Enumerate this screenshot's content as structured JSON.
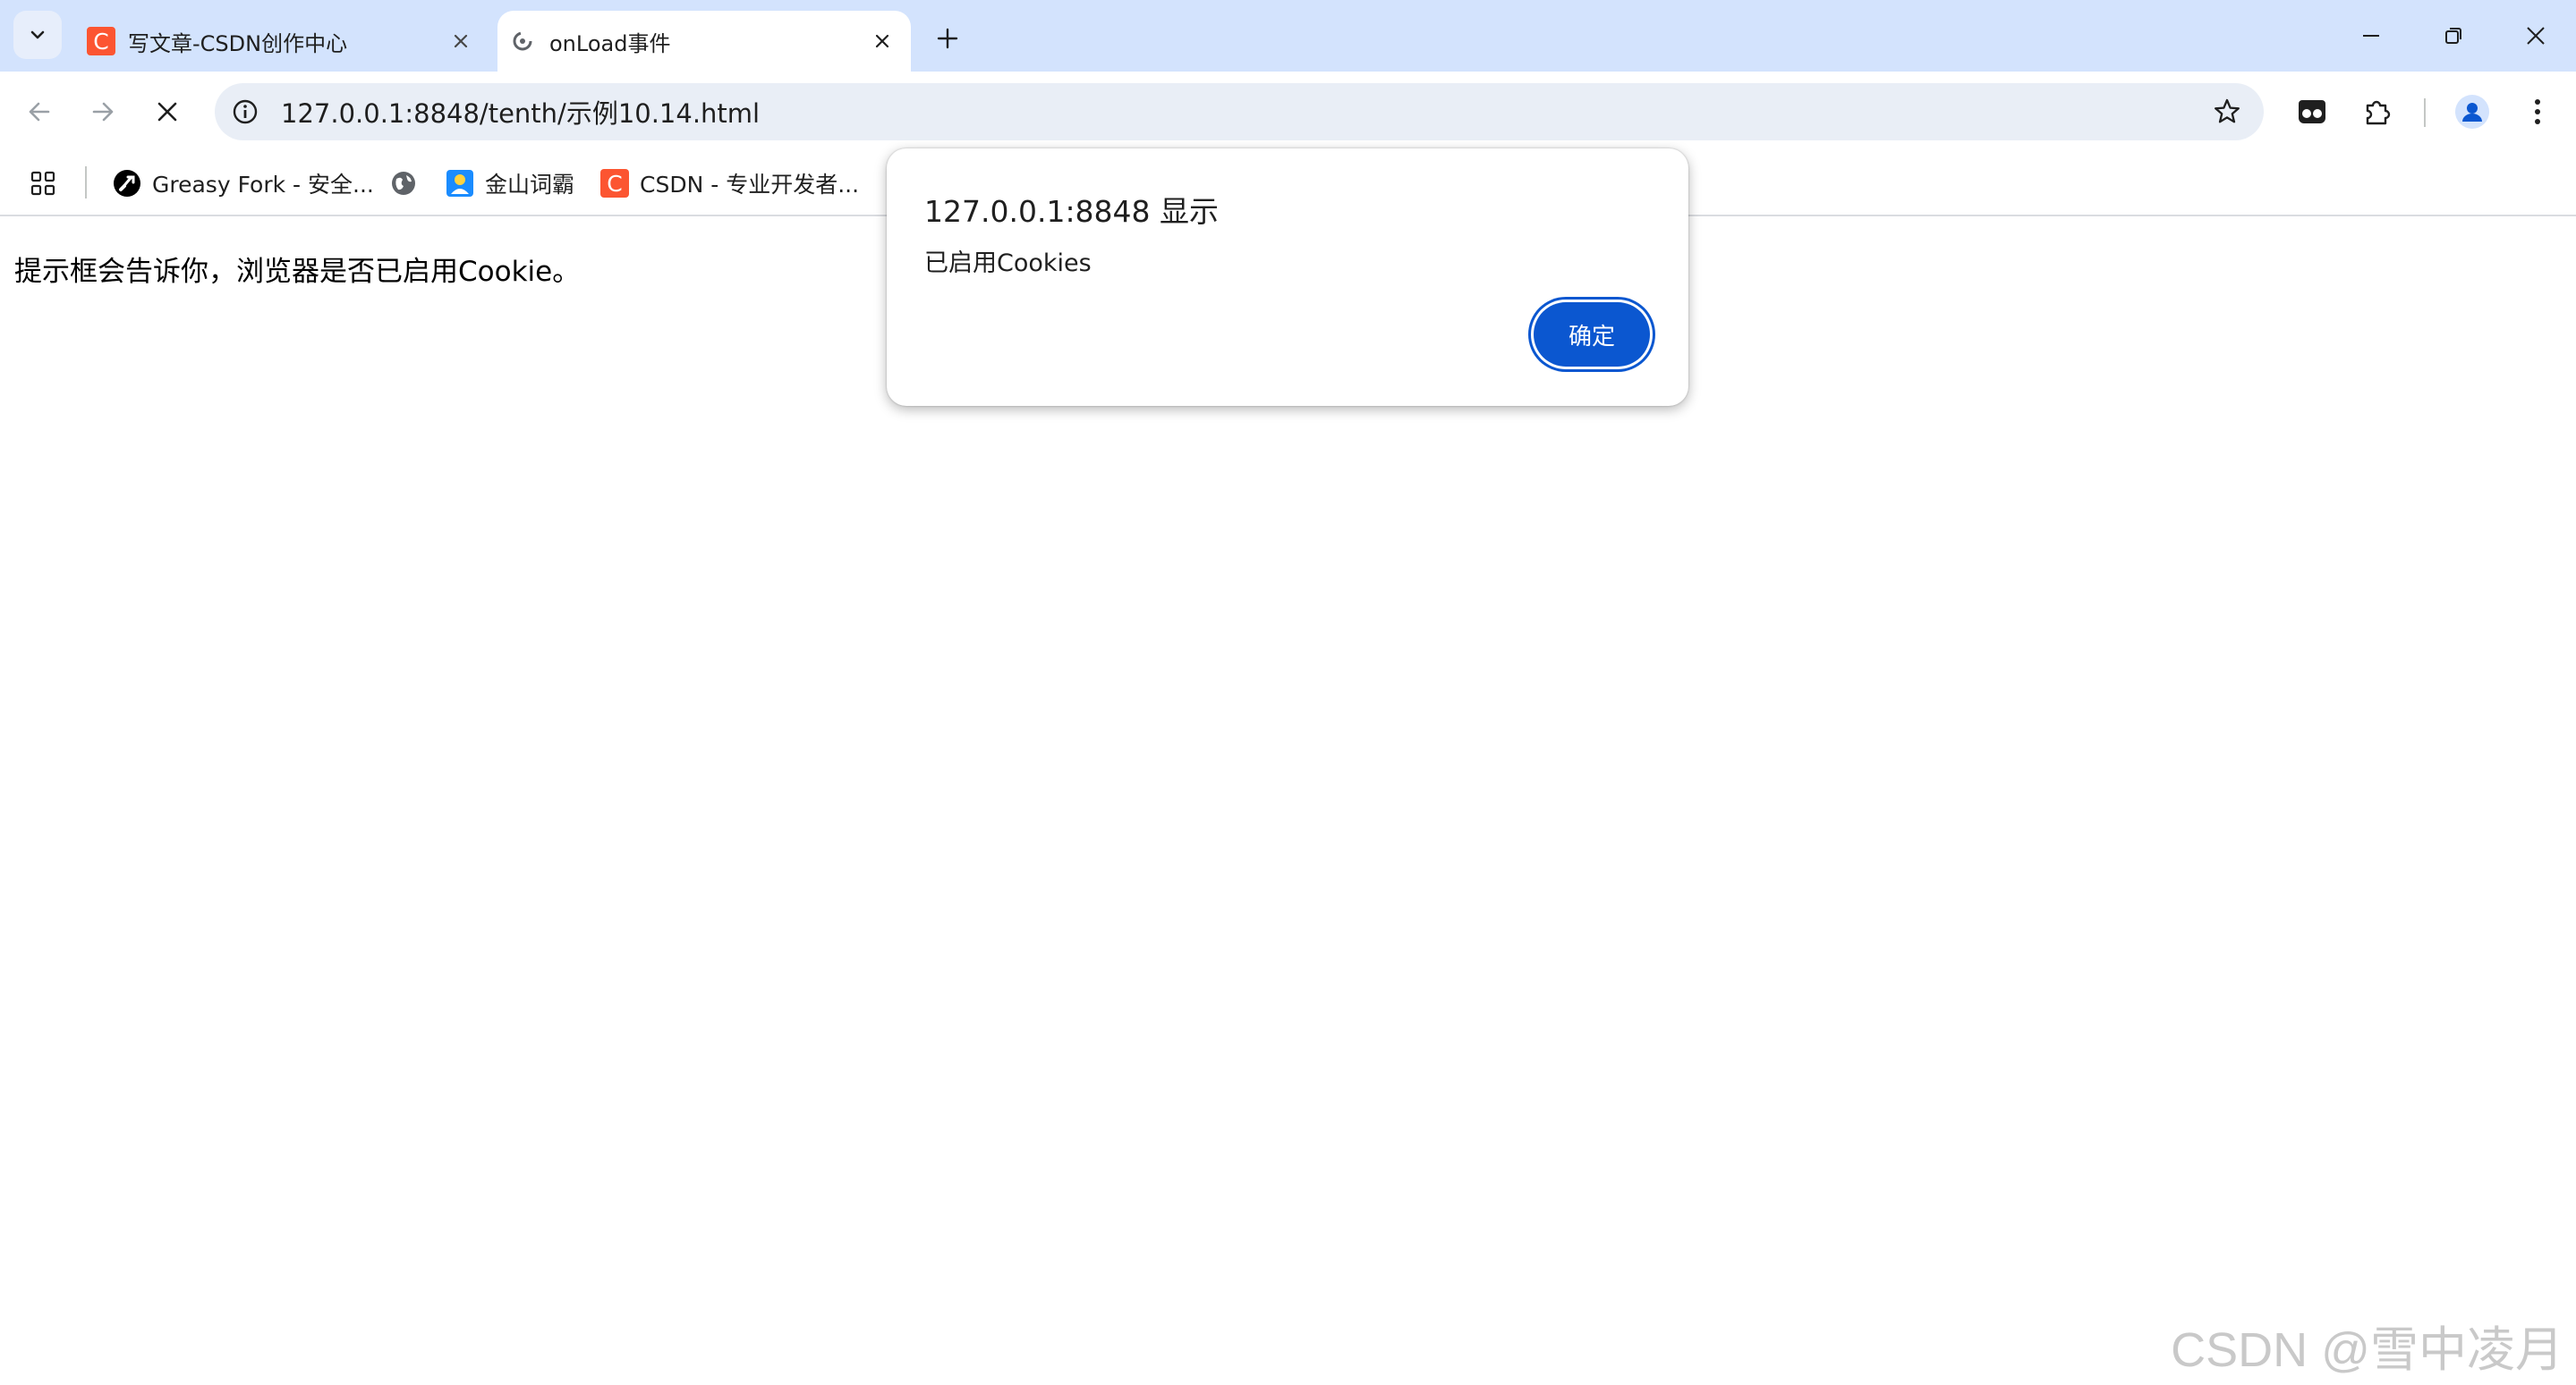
{
  "tabs": [
    {
      "title": "写文章-CSDN创作中心",
      "active": false,
      "favicon": "csdn-logo-icon"
    },
    {
      "title": "onLoad事件",
      "active": true,
      "favicon": "loading-icon"
    }
  ],
  "toolbar": {
    "url": "127.0.0.1:8848/tenth/示例10.14.html"
  },
  "bookmarks": [
    {
      "label": "Greasy Fork - 安全...",
      "icon": "greasyfork-icon"
    },
    {
      "label": "",
      "icon": "globe-icon"
    },
    {
      "label": "金山词霸",
      "icon": "iciba-icon"
    },
    {
      "label": "CSDN - 专业开发者...",
      "icon": "csdn-logo-icon"
    }
  ],
  "page": {
    "text": "提示框会告诉你，浏览器是否已启用Cookie。"
  },
  "dialog": {
    "title": "127.0.0.1:8848 显示",
    "message": "已启用Cookies",
    "ok_label": "确定"
  },
  "watermark": "CSDN @雪中凌月",
  "colors": {
    "tabstrip": "#d3e3fd",
    "omnibox": "#e9eef6",
    "accent": "#0b57d0",
    "csdn": "#fc5531"
  }
}
